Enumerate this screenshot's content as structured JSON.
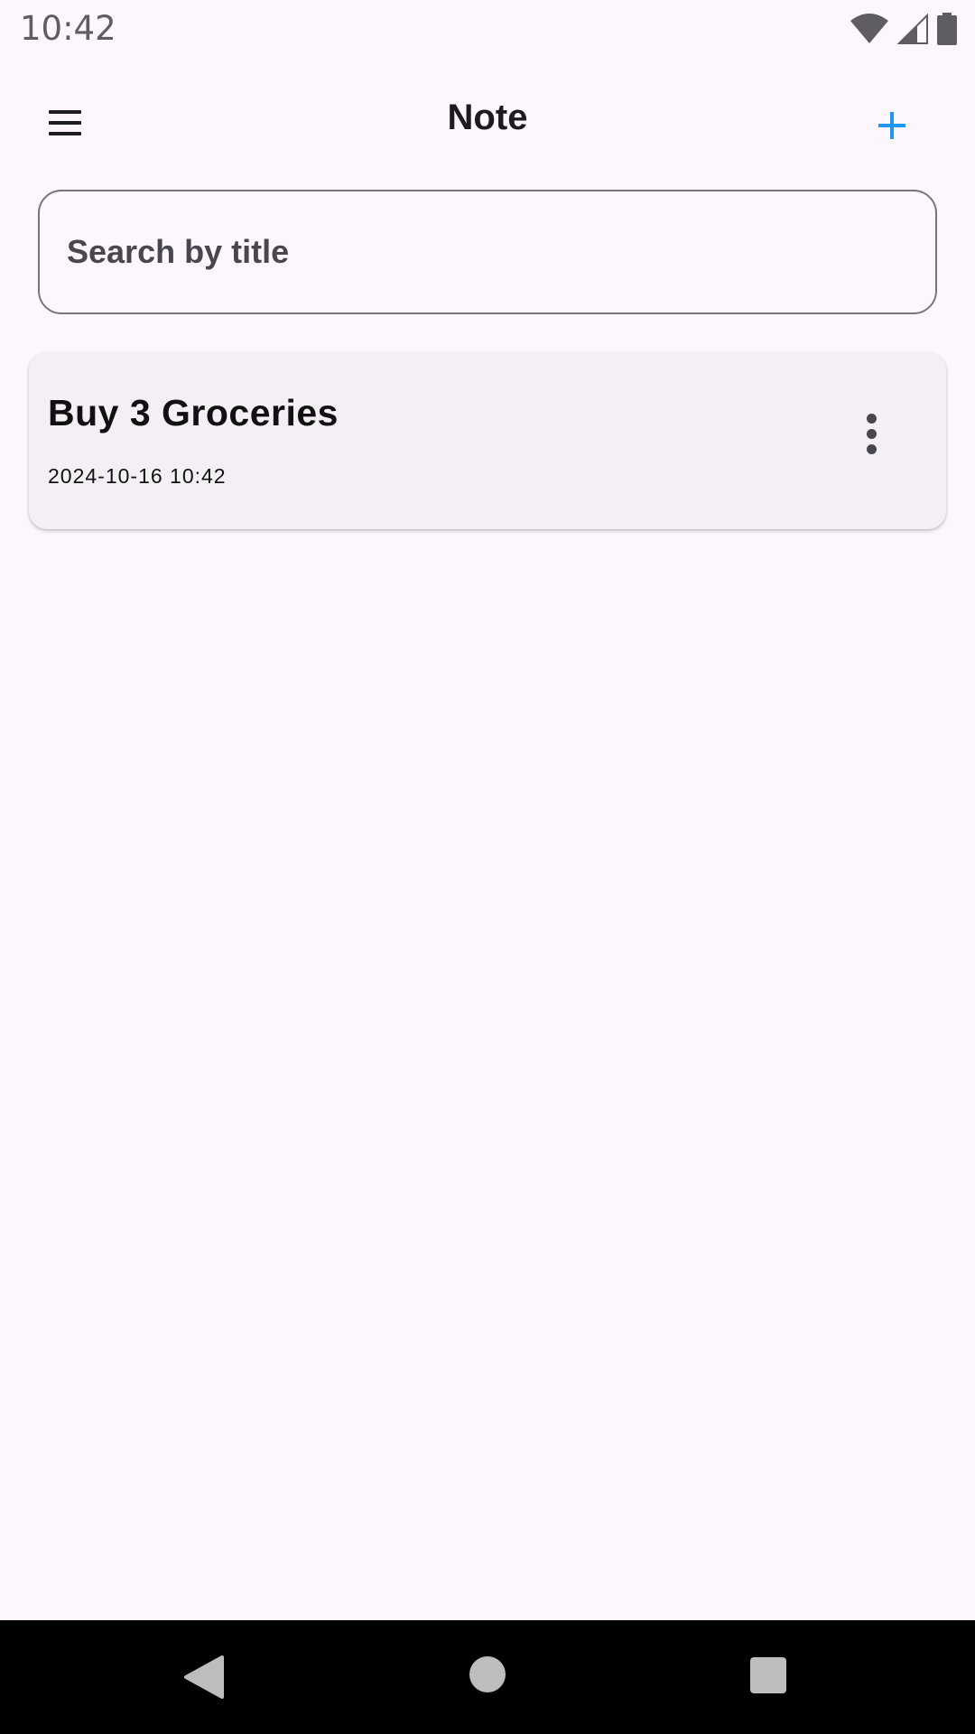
{
  "status_bar": {
    "time": "10:42",
    "icons": [
      "wifi-icon",
      "cell-signal-icon",
      "battery-icon"
    ]
  },
  "app_bar": {
    "title": "Note",
    "menu_icon": "hamburger-menu-icon",
    "add_icon": "plus-icon",
    "accent_color": "#2196F3"
  },
  "search": {
    "placeholder": "Search by title",
    "value": ""
  },
  "notes": [
    {
      "title": "Buy 3 Groceries",
      "date": "2024-10-16 10:42",
      "menu_icon": "more-vert-icon"
    }
  ],
  "nav_bar": {
    "icons": [
      "back-icon",
      "home-icon",
      "recents-icon"
    ]
  },
  "colors": {
    "background": "#FDF7FD",
    "card": "#F4EFF4",
    "outline": "#79747E"
  }
}
